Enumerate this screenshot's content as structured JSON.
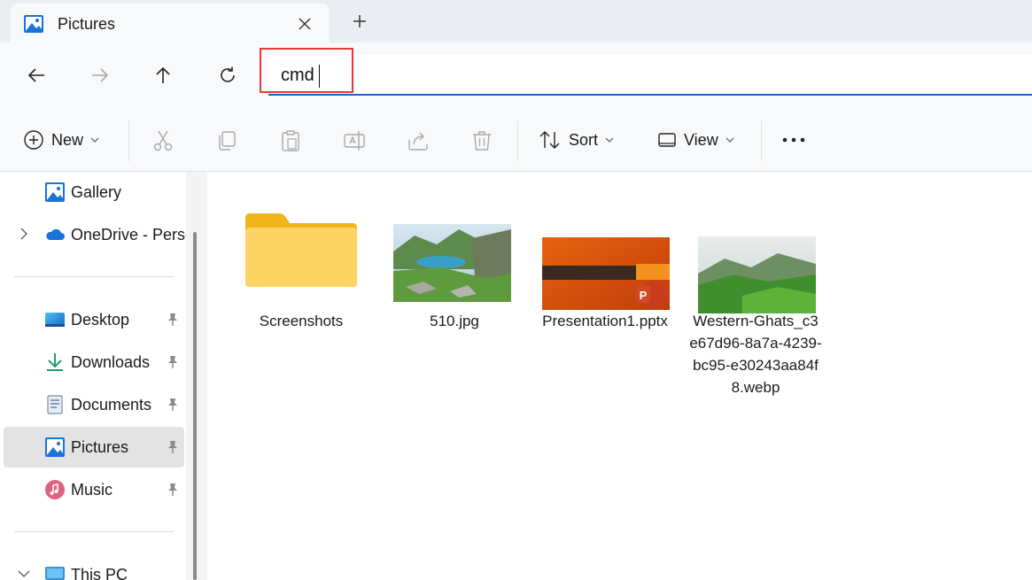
{
  "tab": {
    "title": "Pictures"
  },
  "address": {
    "value": "cmd"
  },
  "toolbar": {
    "new_label": "New",
    "sort_label": "Sort",
    "view_label": "View"
  },
  "sidebar": {
    "items": [
      {
        "label": "Gallery"
      },
      {
        "label": "OneDrive - Perso"
      },
      {
        "label": "Desktop"
      },
      {
        "label": "Downloads"
      },
      {
        "label": "Documents"
      },
      {
        "label": "Pictures"
      },
      {
        "label": "Music"
      },
      {
        "label": "This PC"
      }
    ]
  },
  "files": [
    {
      "name": "Screenshots"
    },
    {
      "name": "510.jpg"
    },
    {
      "name": "Presentation1.pptx"
    },
    {
      "name": "Western-Ghats_c3e67d96-8a7a-4239-bc95-e30243aa84f8.webp"
    }
  ],
  "colors": {
    "accent": "#1f5fbf",
    "highlight": "#e53935",
    "selected": "#e3e3e3"
  }
}
